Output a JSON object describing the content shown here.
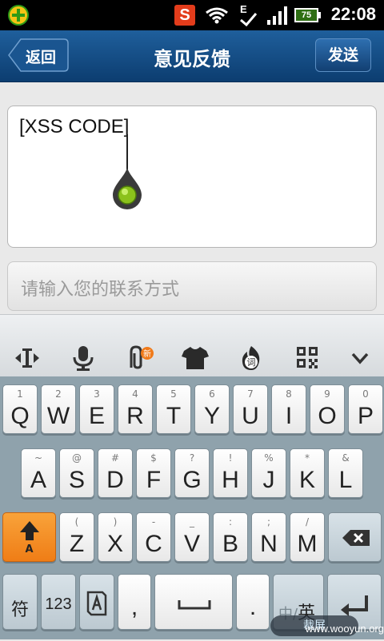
{
  "status_bar": {
    "sogou_glyph": "S",
    "edge_glyph": "E",
    "battery_level": "75",
    "time": "22:08"
  },
  "title_bar": {
    "back_label": "返回",
    "title": "意见反馈",
    "send_label": "发送"
  },
  "form": {
    "feedback_value": "[XSS CODE]",
    "contact_placeholder": "请输入您的联系方式"
  },
  "toolbar": {
    "items": [
      "cursor-move-icon",
      "microphone-icon",
      "paperclip-new-icon",
      "tshirt-icon",
      "word-fire-icon",
      "qr-code-icon",
      "chevron-down-icon"
    ]
  },
  "keyboard": {
    "row1": [
      {
        "hint": "1",
        "key": "Q"
      },
      {
        "hint": "2",
        "key": "W"
      },
      {
        "hint": "3",
        "key": "E"
      },
      {
        "hint": "4",
        "key": "R"
      },
      {
        "hint": "5",
        "key": "T"
      },
      {
        "hint": "6",
        "key": "Y"
      },
      {
        "hint": "7",
        "key": "U"
      },
      {
        "hint": "8",
        "key": "I"
      },
      {
        "hint": "9",
        "key": "O"
      },
      {
        "hint": "0",
        "key": "P"
      }
    ],
    "row2": [
      {
        "hint": "~",
        "key": "A"
      },
      {
        "hint": "@",
        "key": "S"
      },
      {
        "hint": "#",
        "key": "D"
      },
      {
        "hint": "$",
        "key": "F"
      },
      {
        "hint": "?",
        "key": "G"
      },
      {
        "hint": "!",
        "key": "H"
      },
      {
        "hint": "%",
        "key": "J"
      },
      {
        "hint": "*",
        "key": "K"
      },
      {
        "hint": "&",
        "key": "L"
      }
    ],
    "row3": [
      {
        "hint": "(",
        "key": "Z"
      },
      {
        "hint": ")",
        "key": "X"
      },
      {
        "hint": "-",
        "key": "C"
      },
      {
        "hint": "_",
        "key": "V"
      },
      {
        "hint": ":",
        "key": "B"
      },
      {
        "hint": ";",
        "key": "N"
      },
      {
        "hint": "/",
        "key": "M"
      }
    ],
    "shift_label": "A",
    "symbols_label": "符",
    "numbers_label": "123",
    "comma_label": ",",
    "period_label": ".",
    "lang_label_zh": "中/",
    "lang_label_en": "英",
    "crop_label": "裁屏",
    "watermark": "www.wooyun.org"
  }
}
